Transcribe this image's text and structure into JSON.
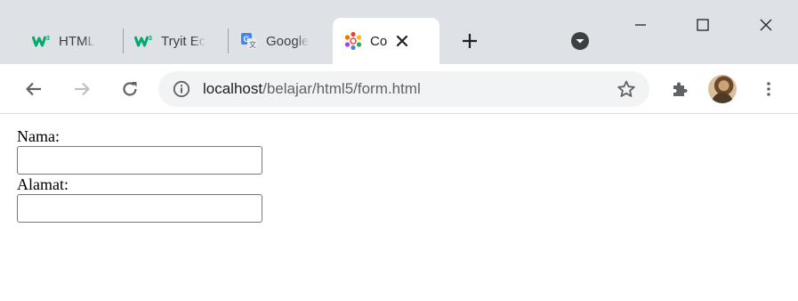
{
  "browser": {
    "tabs": [
      {
        "title": "HTML",
        "favicon": "w3schools-icon",
        "active": false
      },
      {
        "title": "Tryit Ec",
        "favicon": "w3schools-icon",
        "active": false
      },
      {
        "title": "Google",
        "favicon": "google-translate-icon",
        "active": false
      },
      {
        "title": "Co",
        "favicon": "colorful-star-icon",
        "active": true
      }
    ],
    "address": {
      "host": "localhost",
      "path": "/belajar/html5/form.html"
    },
    "colors": {
      "tabstrip": "#dee1e6",
      "omnibox": "#f1f3f4",
      "icon": "#5f6368",
      "w3schools_green": "#04aa6d"
    }
  },
  "form": {
    "nama_label": "Nama:",
    "nama_value": "",
    "alamat_label": "Alamat:",
    "alamat_value": ""
  }
}
